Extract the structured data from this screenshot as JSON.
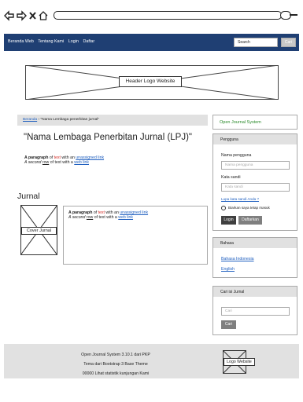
{
  "navbar": {
    "links": [
      "Beranda Web",
      "Tentang Kami",
      "Login",
      "Daftar"
    ],
    "search_placeholder": "Search",
    "search_button": "Cari"
  },
  "header": {
    "label": "Header Logo Website"
  },
  "breadcrumb": {
    "home": "Beranda",
    "separator": "›",
    "current": "\"Nama Lembaga penerbitan jurnal\""
  },
  "main": {
    "title": "\"Nama Lembaga Penerbitan Jurnal (LPJ)\"",
    "para": {
      "l1_a": "A paragraph",
      "l1_b": " of ",
      "l1_c": "text",
      "l1_d": " with an ",
      "l1_e": "unassigned link",
      "l2_a": "A second ",
      "l2_b": "row",
      "l2_c": " of text with a ",
      "l2_d": "web link"
    }
  },
  "jurnal": {
    "heading": "Jurnal",
    "cover_label": "Cover Jurnal",
    "para": {
      "l1_a": "A paragraph",
      "l1_b": " of ",
      "l1_c": "text",
      "l1_d": " with an ",
      "l1_e": "unassigned link",
      "l2_a": "A second ",
      "l2_b": "row",
      "l2_c": " of text with a ",
      "l2_d": "web link"
    }
  },
  "sidebar": {
    "ojs_link": "Open Journal System",
    "pengguna": {
      "title": "Pengguna",
      "username_label": "Nama pengguna",
      "username_placeholder": "Nama pengguna",
      "password_label": "Kata sandi",
      "password_placeholder": "Kata sandi",
      "forgot_link": "Lupa kata sandi Anda ?",
      "remember_label": "Biarkan saya tetap masuk",
      "login_button": "Login",
      "register_button": "Daftarkan"
    },
    "bahasa": {
      "title": "Bahasa",
      "options": [
        "Bahasa Indonesia",
        "English"
      ]
    },
    "cari": {
      "title": "Cari isi Jurnal",
      "placeholder": "Cari",
      "button": "Cari"
    }
  },
  "footer": {
    "line1": "Open Journal System 3.10.1 dari PKP",
    "line2": "Tema dari Bootstrap 3 Base Theme",
    "line3": "00000 Lihat statistik kunjungan Kami",
    "logo_label": "Logo Website"
  },
  "colors": {
    "navbar": "#1f3f73",
    "link": "#1f5fbf",
    "red_text": "#d4302a",
    "green_link": "#2a8a2a",
    "panel_grey": "#e1e1e1"
  }
}
